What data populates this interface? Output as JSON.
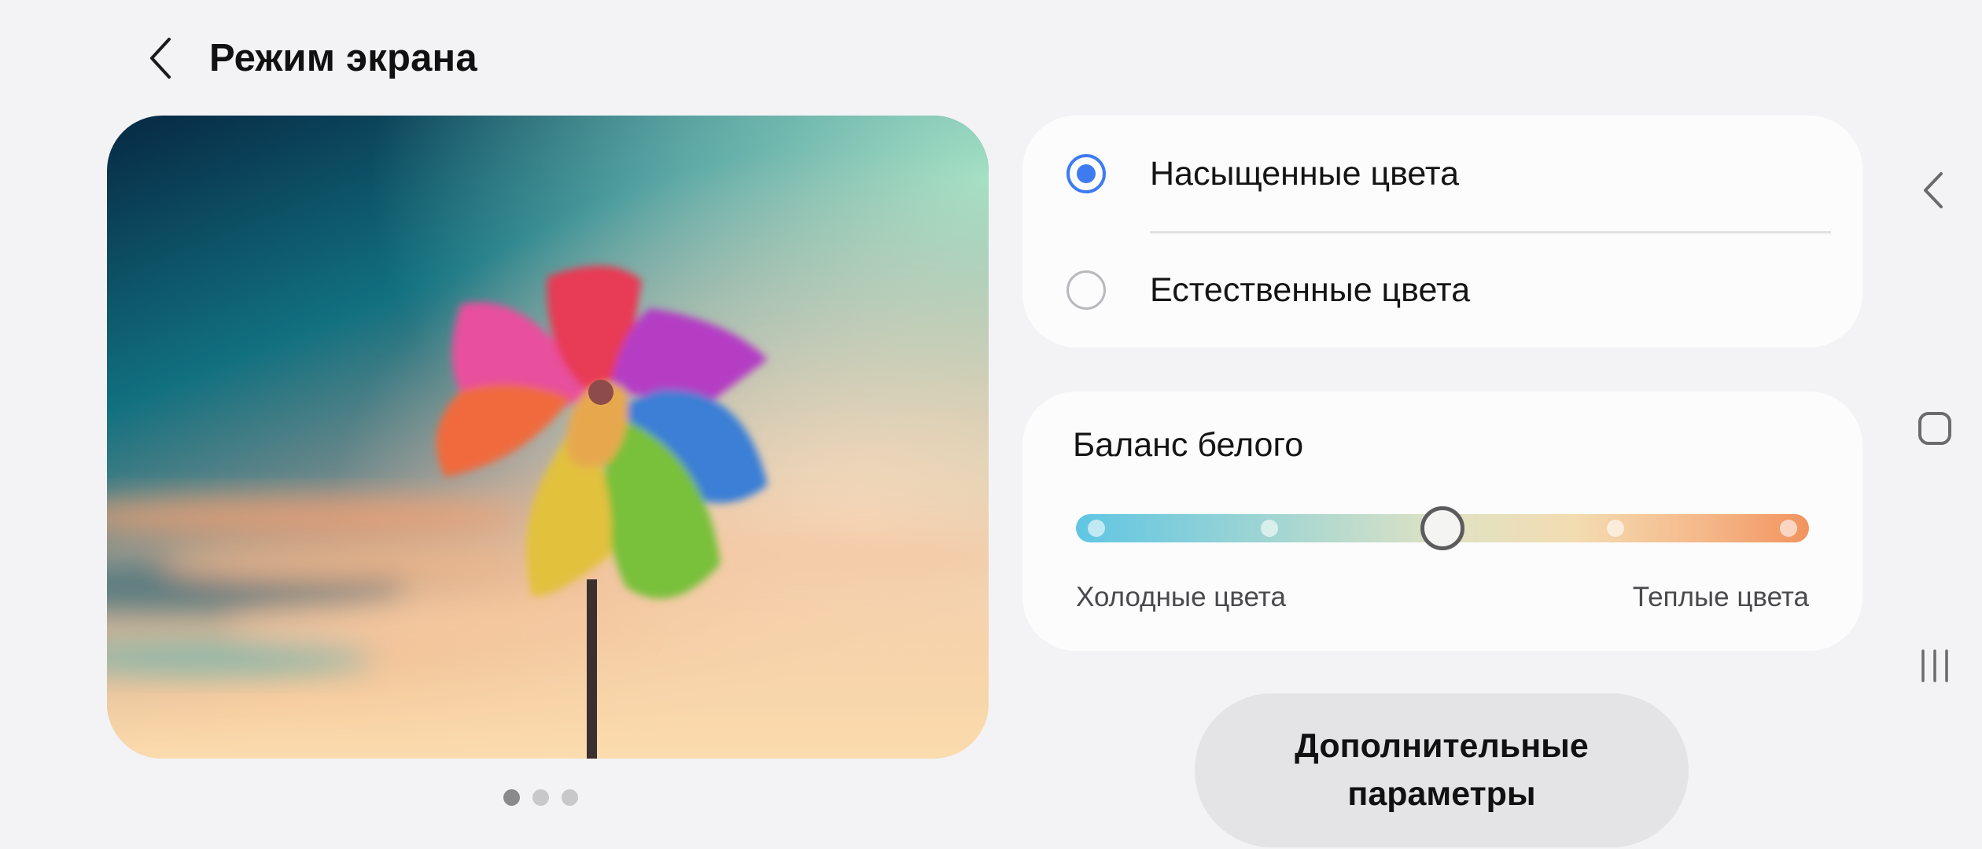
{
  "header": {
    "title": "Режим экрана",
    "back_icon": "chevron-left-icon"
  },
  "preview": {
    "image": "pinwheel-photo",
    "page_count": 3,
    "active_page": 1
  },
  "screen_mode": {
    "options": [
      {
        "label": "Насыщенные цвета",
        "selected": true
      },
      {
        "label": "Естественные цвета",
        "selected": false
      }
    ]
  },
  "white_balance": {
    "title": "Баланс белого",
    "cold_label": "Холодные цвета",
    "warm_label": "Теплые цвета",
    "steps": 5,
    "value_step": 3
  },
  "advanced_button": {
    "label": "Дополнительные\nпараметры"
  },
  "navbar": {
    "icons": [
      "back-icon",
      "home-icon",
      "recents-icon"
    ]
  },
  "colors": {
    "accent": "#3e7bf2",
    "background": "#f3f3f5",
    "card": "#fcfcfd"
  }
}
